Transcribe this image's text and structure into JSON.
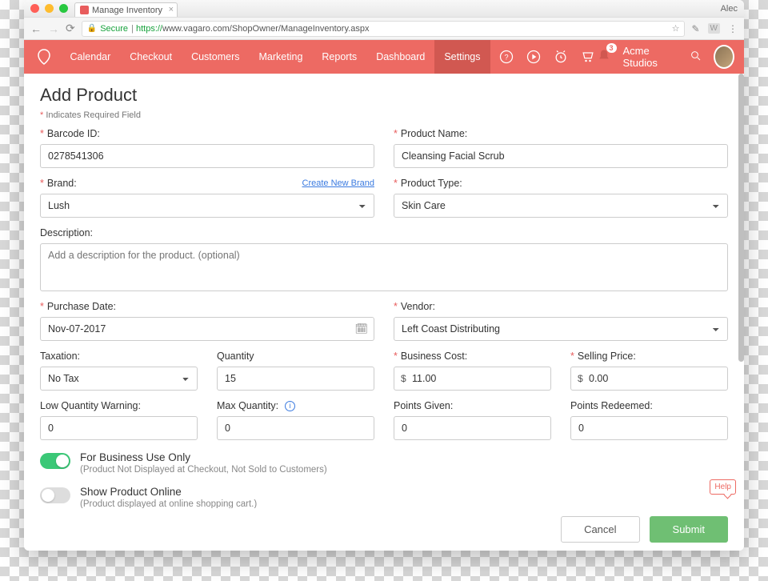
{
  "browser": {
    "tab_title": "Manage Inventory",
    "user": "Alec",
    "secure_label": "Secure",
    "url_https": "https://",
    "url_domain": "www.vagaro.com",
    "url_path": "/ShopOwner/ManageInventory.aspx"
  },
  "nav": {
    "links": [
      "Calendar",
      "Checkout",
      "Customers",
      "Marketing",
      "Reports",
      "Dashboard",
      "Settings"
    ],
    "active_index": 6,
    "notification_count": "3",
    "company": "Acme Studios"
  },
  "page": {
    "title": "Add Product",
    "required_note": "Indicates Required Field"
  },
  "form": {
    "barcode": {
      "label": "Barcode ID:",
      "value": "0278541306"
    },
    "product_name": {
      "label": "Product Name:",
      "value": "Cleansing Facial Scrub"
    },
    "brand": {
      "label": "Brand:",
      "link": "Create New Brand",
      "value": "Lush"
    },
    "product_type": {
      "label": "Product Type:",
      "value": "Skin Care"
    },
    "description": {
      "label": "Description:",
      "placeholder": "Add a description for the product. (optional)"
    },
    "purchase_date": {
      "label": "Purchase Date:",
      "value": "Nov-07-2017"
    },
    "vendor": {
      "label": "Vendor:",
      "value": "Left Coast Distributing"
    },
    "taxation": {
      "label": "Taxation:",
      "value": "No Tax"
    },
    "quantity": {
      "label": "Quantity",
      "value": "15"
    },
    "business_cost": {
      "label": "Business Cost:",
      "currency": "$",
      "value": "11.00"
    },
    "selling_price": {
      "label": "Selling Price:",
      "currency": "$",
      "value": "0.00"
    },
    "low_qty": {
      "label": "Low Quantity Warning:",
      "value": "0"
    },
    "max_qty": {
      "label": "Max Quantity:",
      "value": "0"
    },
    "points_given": {
      "label": "Points Given:",
      "value": "0"
    },
    "points_redeemed": {
      "label": "Points Redeemed:",
      "value": "0"
    },
    "biz_only": {
      "label": "For Business Use Only",
      "sub": "(Product Not Displayed at Checkout, Not Sold to Customers)"
    },
    "show_online": {
      "label": "Show Product Online",
      "sub": "(Product displayed at online shopping cart.)"
    }
  },
  "buttons": {
    "cancel": "Cancel",
    "submit": "Submit"
  },
  "help": "Help"
}
